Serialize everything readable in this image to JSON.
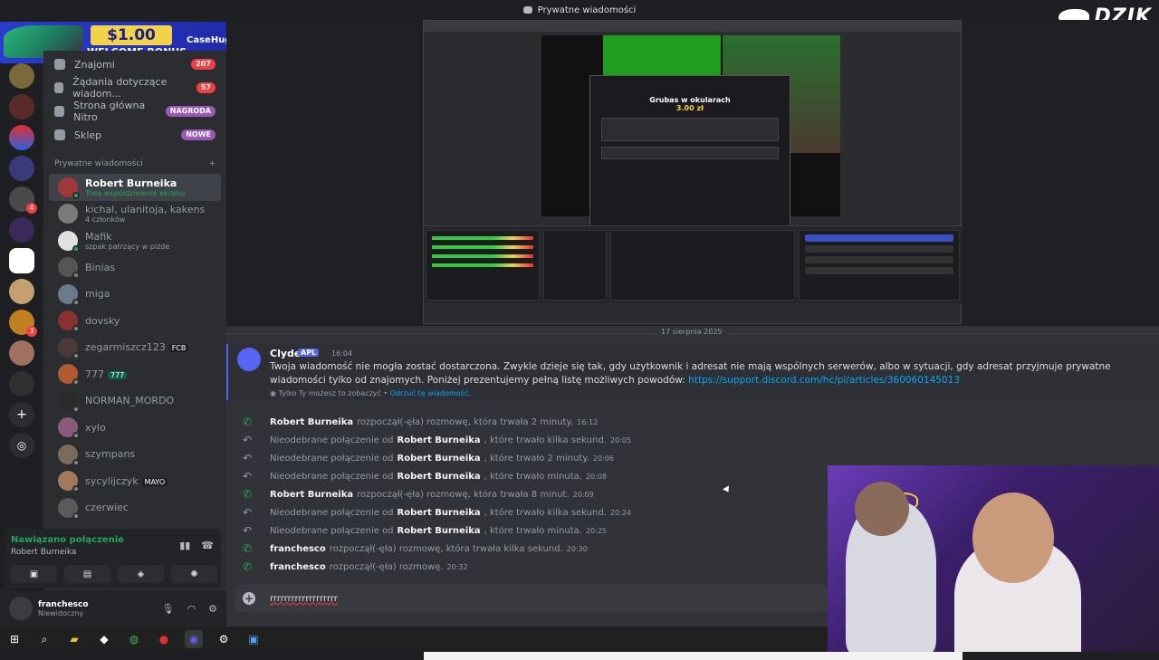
{
  "window": {
    "title": "Prywatne wiadomości"
  },
  "overlay": {
    "brand": "DZIK",
    "promo_amount": "$1.00",
    "promo_text": "WELCOME BONUS",
    "promo_brand": "CaseHug"
  },
  "nav": {
    "items": [
      {
        "label": "Znajomi",
        "badge": "207"
      },
      {
        "label": "Żądania dotyczące wiadom...",
        "badge": "57"
      },
      {
        "label": "Strona główna Nitro",
        "badge": "NAGRODA"
      },
      {
        "label": "Sklep",
        "badge": "NOWE"
      }
    ]
  },
  "dm_section": {
    "title": "Prywatne wiadomości",
    "add": "+"
  },
  "dms": [
    {
      "name": "Robert Burneika",
      "sub": "Trwa współdzielenie ekranu",
      "tag": ""
    },
    {
      "name": "kichal, ulanitoja, kakens",
      "sub": "4 członków",
      "tag": ""
    },
    {
      "name": "Mafik",
      "sub": "szpak patrzący w pizde",
      "tag": ""
    },
    {
      "name": "Binias",
      "sub": "",
      "tag": ""
    },
    {
      "name": "miga",
      "sub": "",
      "tag": ""
    },
    {
      "name": "dovsky",
      "sub": "",
      "tag": ""
    },
    {
      "name": "zegarmiszcz123",
      "sub": "",
      "tag": "FCB"
    },
    {
      "name": "777",
      "sub": "",
      "tag": "777"
    },
    {
      "name": "NORMAN_MORDO",
      "sub": "",
      "tag": ""
    },
    {
      "name": "xylo",
      "sub": "",
      "tag": ""
    },
    {
      "name": "szympans",
      "sub": "",
      "tag": ""
    },
    {
      "name": "sycylijczyk",
      "sub": "",
      "tag": "MAYO"
    },
    {
      "name": "czerwiec",
      "sub": "",
      "tag": ""
    }
  ],
  "voice": {
    "status": "Nawiązano połączenie",
    "peer": "Robert Burneika"
  },
  "user": {
    "name": "franchesco",
    "status": "Niewidoczny"
  },
  "stream": {
    "obs_dialog_title": "Grubas w okularach",
    "obs_dialog_price": "3.00 zł"
  },
  "chat": {
    "date": "17 sierpnia 2025",
    "system": {
      "author": "Clyde",
      "app": "APL",
      "time": "16:04",
      "text": "Twoja wiadomość nie mogła zostać dostarczona. Zwykle dzieje się tak, gdy użytkownik i adresat nie mają wspólnych serwerów, albo w sytuacji, gdy adresat przyjmuje prywatne wiadomości tylko od znajomych. Poniżej prezentujemy pełną listę możliwych powodów:",
      "link": "https://support.discord.com/hc/pl/articles/360060145013",
      "note": "Tylko Ty możesz to zobaczyć •",
      "dismiss": "Odrzuć tę wiadomość."
    },
    "calls": [
      {
        "pre": "",
        "who": "Robert Burneika",
        "post": "rozpoczął(-ęła) rozmowę, która trwała 2 minuty.",
        "time": "16:12",
        "missed": false
      },
      {
        "pre": "Nieodebrane połączenie od",
        "who": "Robert Burneika",
        "post": ", które trwało kilka sekund.",
        "time": "20:05",
        "missed": true
      },
      {
        "pre": "Nieodebrane połączenie od",
        "who": "Robert Burneika",
        "post": ", które trwało 2 minuty.",
        "time": "20:06",
        "missed": true
      },
      {
        "pre": "Nieodebrane połączenie od",
        "who": "Robert Burneika",
        "post": ", które trwało minuta.",
        "time": "20:08",
        "missed": true
      },
      {
        "pre": "",
        "who": "Robert Burneika",
        "post": "rozpoczął(-ęła) rozmowę, która trwała 8 minut.",
        "time": "20:09",
        "missed": false
      },
      {
        "pre": "Nieodebrane połączenie od",
        "who": "Robert Burneika",
        "post": ", które trwało kilka sekund.",
        "time": "20:24",
        "missed": true
      },
      {
        "pre": "Nieodebrane połączenie od",
        "who": "Robert Burneika",
        "post": ", które trwało minuta.",
        "time": "20:25",
        "missed": true
      },
      {
        "pre": "",
        "who": "franchesco",
        "post": "rozpoczął(-ęła) rozmowę, która trwała kilka sekund.",
        "time": "20:30",
        "missed": false
      },
      {
        "pre": "",
        "who": "franchesco",
        "post": "rozpoczął(-ęła) rozmowę.",
        "time": "20:32",
        "missed": false
      }
    ],
    "composer_text": "rrrrrrrrrrrrrrrrrrr"
  },
  "colors": {
    "accent": "#5865f2",
    "online": "#23a55a",
    "danger": "#f23f43",
    "link": "#00a8fc"
  }
}
